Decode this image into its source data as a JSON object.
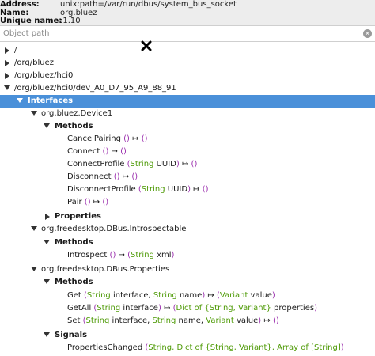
{
  "connection": {
    "address_label": "Address:",
    "address": "unix:path=/var/run/dbus/system_bus_socket",
    "name_label": "Name:",
    "name": "org.bluez",
    "unique_label": "Unique name:",
    "unique": ":1.10"
  },
  "search": {
    "placeholder": "Object path",
    "value": ""
  },
  "tree": {
    "paths": [
      "/",
      "/org/bluez",
      "/org/bluez/hci0",
      "/org/bluez/hci0/dev_A0_D7_95_A9_88_91"
    ],
    "interfaces_label": "Interfaces",
    "device_iface": "org.bluez.Device1",
    "methods_label": "Methods",
    "properties_label": "Properties",
    "signals_label": "Signals",
    "device_methods": [
      {
        "name": "CancelPairing",
        "args": "()",
        "arrow": "↦",
        "ret": "()"
      },
      {
        "name": "Connect",
        "args": "()",
        "arrow": "↦",
        "ret": "()"
      },
      {
        "name": "ConnectProfile",
        "open": "(",
        "type1": "String",
        "arg1": "UUID",
        "close": ")",
        "arrow": "↦",
        "ret": "()"
      },
      {
        "name": "Disconnect",
        "args": "()",
        "arrow": "↦",
        "ret": "()"
      },
      {
        "name": "DisconnectProfile",
        "open": "(",
        "type1": "String",
        "arg1": "UUID",
        "close": ")",
        "arrow": "↦",
        "ret": "()"
      },
      {
        "name": "Pair",
        "args": "()",
        "arrow": "↦",
        "ret": "()"
      }
    ],
    "introspectable_iface": "org.freedesktop.DBus.Introspectable",
    "introspect": {
      "name": "Introspect",
      "args": "()",
      "arrow": "↦",
      "open": "(",
      "type1": "String",
      "arg1": "xml",
      "close": ")"
    },
    "properties_iface": "org.freedesktop.DBus.Properties",
    "get": {
      "name": "Get",
      "open": "(",
      "t1": "String",
      "a1": "interface,",
      "t2": "String",
      "a2": "name",
      "close": ")",
      "arrow": "↦",
      "ropen": "(",
      "rt": "Variant",
      "ra": "value",
      "rclose": ")"
    },
    "getall": {
      "name": "GetAll",
      "open": "(",
      "t1": "String",
      "a1": "interface",
      "close": ")",
      "arrow": "↦",
      "ropen": "(",
      "rt": "Dict of {String, Variant}",
      "ra": "properties",
      "rclose": ")"
    },
    "set": {
      "name": "Set",
      "open": "(",
      "t1": "String",
      "a1": "interface,",
      "t2": "String",
      "a2": "name,",
      "t3": "Variant",
      "a3": "value",
      "close": ")",
      "arrow": "↦",
      "ret": "()"
    },
    "signal": {
      "name": "PropertiesChanged",
      "open": "(",
      "t1": "String,",
      "t2": "Dict of {String, Variant},",
      "t3": "Array of [String]",
      "close": ")"
    }
  },
  "colors": {
    "selection": "#4a90d9",
    "keyword": "#9b2fae",
    "type": "#4e9a06"
  },
  "icons": {
    "collapsed": "triangle-right",
    "expanded": "triangle-down",
    "clear": "clear-circle-icon",
    "cursor": "x-cursor-icon"
  }
}
